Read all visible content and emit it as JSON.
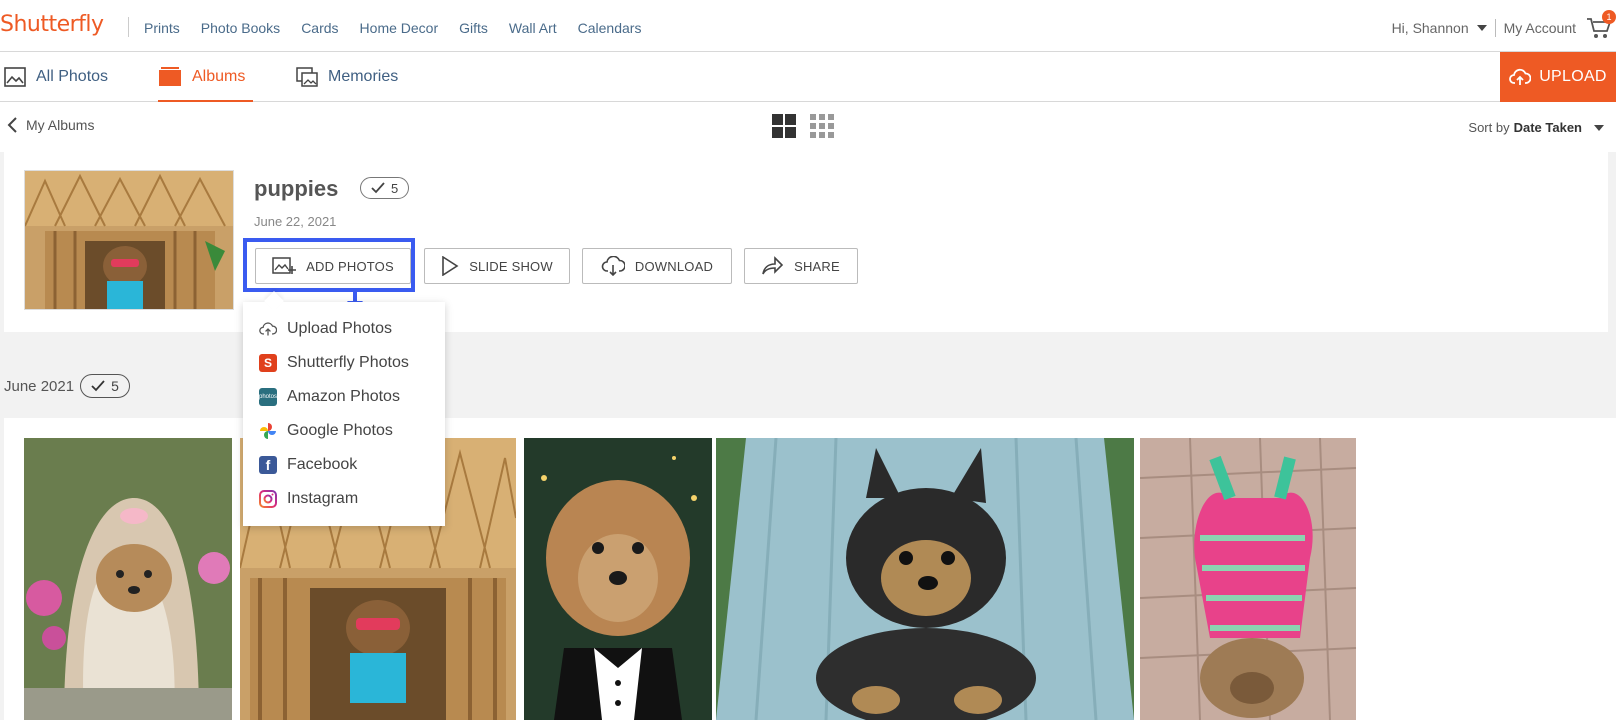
{
  "brand": {
    "logo": "Shutterfly",
    "accent": "#ee5a24",
    "highlight": "#3a5bf0"
  },
  "topnav": {
    "items": [
      "Prints",
      "Photo Books",
      "Cards",
      "Home Decor",
      "Gifts",
      "Wall Art",
      "Calendars"
    ]
  },
  "account": {
    "greeting": "Hi, Shannon",
    "my_account": "My Account",
    "cart_count": "1"
  },
  "tabs": [
    {
      "label": "All Photos",
      "icon": "image-icon"
    },
    {
      "label": "Albums",
      "icon": "album-icon"
    },
    {
      "label": "Memories",
      "icon": "memories-icon"
    }
  ],
  "upload": {
    "label": "UPLOAD"
  },
  "subbar": {
    "back_label": "My Albums",
    "sort_prefix": "Sort by",
    "sort_value": "Date Taken"
  },
  "album": {
    "title": "puppies",
    "count": "5",
    "date": "June 22, 2021",
    "actions": {
      "add_photos": "ADD PHOTOS",
      "slide_show": "SLIDE SHOW",
      "download": "DOWNLOAD",
      "share": "SHARE"
    }
  },
  "dropdown": {
    "items": [
      {
        "label": "Upload Photos",
        "icon": "cloud-upload-icon"
      },
      {
        "label": "Shutterfly Photos",
        "icon": "shutterfly-icon"
      },
      {
        "label": "Amazon Photos",
        "icon": "amazon-photos-icon"
      },
      {
        "label": "Google Photos",
        "icon": "google-photos-icon"
      },
      {
        "label": "Facebook",
        "icon": "facebook-icon"
      },
      {
        "label": "Instagram",
        "icon": "instagram-icon"
      }
    ]
  },
  "group": {
    "label": "June 2021",
    "count": "5"
  }
}
